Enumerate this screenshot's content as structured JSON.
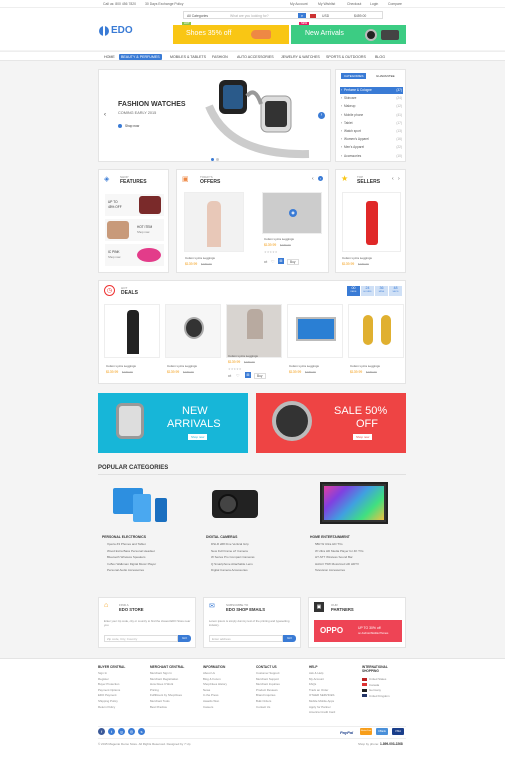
{
  "topbar": {
    "phone": "Call us: 800 456 7820",
    "policy": "30 Days Exchange Policy",
    "account": "My Account",
    "wishlist": "My Wishlist",
    "checkout": "Checkout",
    "login": "Login",
    "compare": "Compare"
  },
  "header": {
    "logo": "EDO",
    "category_select": "All Categories",
    "search_placeholder": "What are you looking for?",
    "currency": "USD",
    "cart": "$459.00",
    "promo1": "Shoes 35% off",
    "promo2": "New Arrivals",
    "badge_hot": "HOT",
    "badge_new": "NEW"
  },
  "nav": [
    "HOME",
    "BEAUTY & PERFUMES",
    "MOBILES & TABLETS",
    "FASHION",
    "AUTO ACCESSORIES",
    "JEWELRY & WATCHES",
    "SPORTS & OUTDOORS",
    "BLOG"
  ],
  "slider": {
    "title": "FASHION WATCHES",
    "subtitle": "COMING EARLY 2015",
    "cta": "Shop now"
  },
  "categories_tabs": [
    "CATEGORIES",
    "GUARANTEE"
  ],
  "categories": [
    {
      "name": "Perfume & Cologne",
      "count": "(37)"
    },
    {
      "name": "Skincare",
      "count": "(24)"
    },
    {
      "name": "Makeup",
      "count": "(12)"
    },
    {
      "name": "Mobile phone",
      "count": "(41)"
    },
    {
      "name": "Tablet",
      "count": "(17)"
    },
    {
      "name": "Watch sport",
      "count": "(13)"
    },
    {
      "name": "Women's Apparel",
      "count": "(16)"
    },
    {
      "name": "Men's Apparel",
      "count": "(22)"
    },
    {
      "name": "Accessories",
      "count": "(10)"
    }
  ],
  "shop_features": {
    "kicker": "SHOP",
    "title": "FEATURES",
    "b1_line1": "UP TO",
    "b1_line2": "45% OFF",
    "b2_line1": "HOT ITEM",
    "b2_line2": "Shop now",
    "b3_line1": "IC PINK",
    "b3_line2": "Shop now"
  },
  "todays_offers": {
    "kicker": "TODAY'S",
    "title": "OFFERS",
    "p1_name": "Cotton Lycra Leggings",
    "p1_price": "$139.99",
    "p1_old": "$189.99",
    "p2_name": "Cotton Lycra Leggings",
    "p2_price": "$139.99",
    "p2_old": "$189.99",
    "buy": "Buy"
  },
  "top_sellers": {
    "kicker": "TOP",
    "title": "SELLERS",
    "p_name": "Cotton Lycra Leggings",
    "p_price": "$139.99",
    "p_old": "$189.99"
  },
  "hot_deals": {
    "kicker": "HOT",
    "title": "DEALS",
    "countdown": [
      "00",
      "24",
      "36",
      "48"
    ],
    "countdown_labels": [
      "DAYS",
      "HOURS",
      "MINS",
      "SECS"
    ],
    "products": [
      {
        "name": "Cotton Lycra Leggings",
        "price": "$139.99",
        "old": "$189.99"
      },
      {
        "name": "Cotton Lycra Leggings",
        "price": "$139.99",
        "old": "$189.99"
      },
      {
        "name": "Cotton Lycra Leggings",
        "price": "$139.99",
        "old": "$189.99"
      },
      {
        "name": "Cotton Lycra Leggings",
        "price": "$139.99",
        "old": "$189.99"
      },
      {
        "name": "Cotton Lycra Leggings",
        "price": "$139.99",
        "old": "$189.99"
      }
    ],
    "buy": "Buy"
  },
  "banner1": {
    "line1": "NEW",
    "line2": "ARRIVALS",
    "cta": "Shop now"
  },
  "banner2": {
    "line1": "SALE 50%",
    "line2": "OFF",
    "cta": "Shop now"
  },
  "popular": {
    "title": "POPULAR CATEGORIES",
    "cols": [
      {
        "heading": "PERSONAL ELECTRONICS",
        "items": [
          "Xperia Z3 Phones and Tablet",
          "Wood Extra Bass Personal Headset",
          "Bluetooth Wireless Speakers",
          "In-Box Walkman Digital Music Player",
          "Personal Audio Accessories"
        ]
      },
      {
        "heading": "DIGITAL CAMERAS",
        "items": [
          "DSLR a58 Fine Vertical Grip",
          "New Full Frame a7 Camera",
          "W Series Pro Compact Cameras",
          "Q Smartphone Attachable Lens",
          "Digital Camera Accessories"
        ]
      },
      {
        "heading": "HOME ENTERTAINMENT",
        "items": [
          "58R W Ultra HD TVs",
          "W Ultra HD Media Player for 4K TVs",
          "HT-ST7 Wireless Sound Bar",
          "HAGO 75W Motorized HD HDTV",
          "Television Accessories"
        ]
      }
    ]
  },
  "find_store": {
    "kicker": "FIND A",
    "title": "EDO STORE",
    "text": "Enter your zip code, city or country to find the closest EDO Store near you",
    "placeholder": "Zip code, City, Country",
    "go": "GO"
  },
  "subscribe": {
    "kicker": "SUBSCRIBE TO",
    "title": "EDO SHOP EMAILS",
    "text": "Lorem ipsum is simply dummy text of the printing and typesetting industry.",
    "placeholder": "Enter address",
    "go": "GO"
  },
  "partners": {
    "kicker": "OUR",
    "title": "PARTNERS",
    "logo": "OPPO",
    "offer1": "UP TO 30% off",
    "offer2": "on Android Mobile Phones"
  },
  "footer": {
    "cols": [
      {
        "heading": "BUYER CENTRAL",
        "items": [
          "Sign In",
          "Register",
          "Buyer Protection",
          "Payment Options",
          "EDO Payment",
          "Shipping Policy",
          "Return Policy"
        ]
      },
      {
        "heading": "MERCHANT CENTRAL",
        "items": [
          "Merchant Sign In",
          "Merchant Registration",
          "How Does It Work",
          "Pricing",
          "Fulfillment by ShopClues",
          "Merchant Tools",
          "Best Practice"
        ]
      },
      {
        "heading": "INFORMATION",
        "items": [
          "About Us",
          "Blog & Forum",
          "ShopClues History",
          "News",
          "In the Press",
          "Awards Won",
          "Careers"
        ]
      },
      {
        "heading": "CONTACT US",
        "items": [
          "Customer Support",
          "Merchant Support",
          "Merchant Inquiries",
          "Product Reviews",
          "Brand Inquiries",
          "Bulk Orders",
          "Contact Us"
        ]
      },
      {
        "heading": "HELP",
        "items": [
          "Ask & Help",
          "My Account",
          "FAQs",
          "Track an Order",
          "OTHER SERVICES",
          "Mobile Mobile Apps",
          "Apply for Partner",
          "America Credit Card"
        ]
      },
      {
        "heading": "INTERNATIONAL SHOPPING",
        "items": [
          "United States",
          "Canada",
          "Germany",
          "United Kingdom"
        ]
      }
    ],
    "copyright": "© 2015 Magento Demo Store. All Rights Reserved. Designed by 7 Up",
    "phone_label": "Shop by phone:",
    "phone": "1-899-003-2268",
    "payments": [
      "PayPal",
      "MasterCard",
      "CBank",
      "VISA"
    ]
  },
  "colors": {
    "accent": "#3a7bd5",
    "promo_yellow": "#f9c614",
    "promo_green": "#3ccc83",
    "cyan_banner": "#17b6d8",
    "red_banner": "#ee4444"
  }
}
